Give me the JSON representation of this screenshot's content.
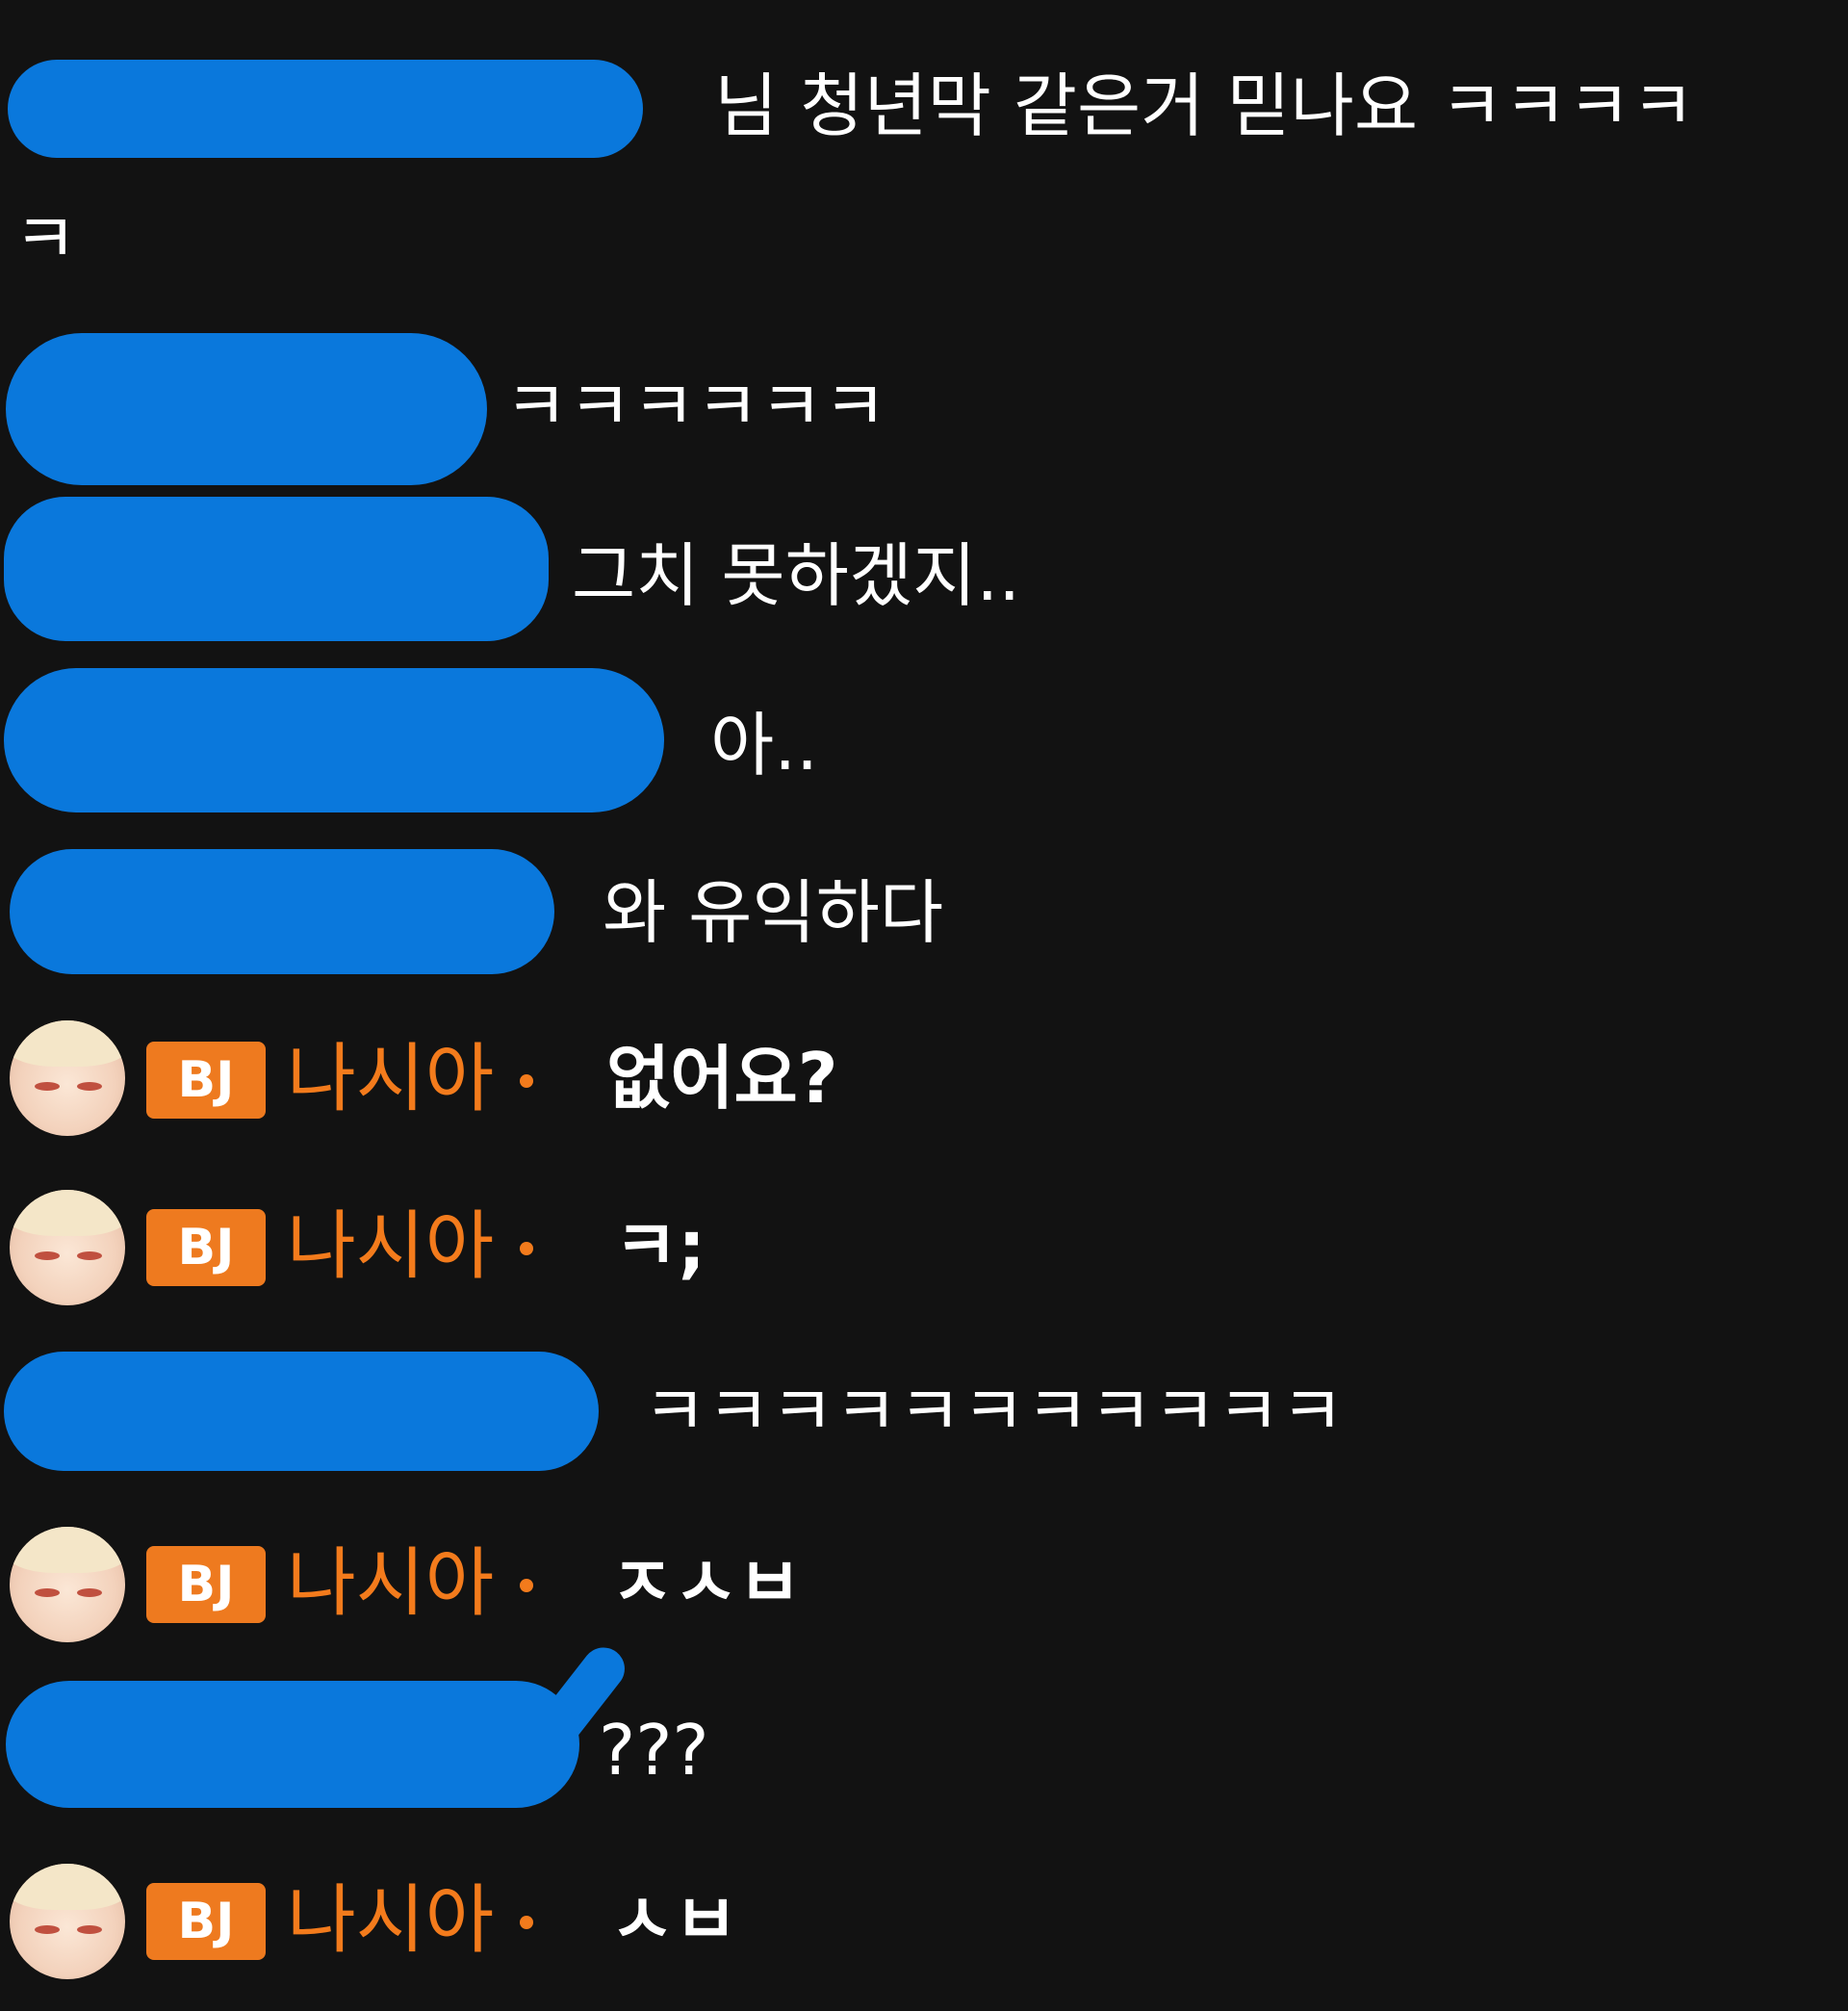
{
  "chat": {
    "messages": [
      {
        "user": "",
        "redacted": true,
        "text": "님 청년막 같은거 믿나요 ㅋㅋㅋㅋ",
        "text_cont": "ㅋ"
      },
      {
        "user": "",
        "redacted": true,
        "text": "ㅋㅋㅋㅋㅋㅋ"
      },
      {
        "user": "",
        "redacted": true,
        "text": "그치 못하겠지.."
      },
      {
        "user": "",
        "redacted": true,
        "text": "아.."
      },
      {
        "user": "",
        "redacted": true,
        "text": "와 유익하다"
      },
      {
        "user": "나시아",
        "badge": "BJ",
        "text": "없어요?"
      },
      {
        "user": "나시아",
        "badge": "BJ",
        "text": "ㅋ;"
      },
      {
        "user": "",
        "redacted": true,
        "text": "ㅋㅋㅋㅋㅋㅋㅋㅋㅋㅋㅋ"
      },
      {
        "user": "나시아",
        "badge": "BJ",
        "text": "ㅈㅅㅂ"
      },
      {
        "user": "",
        "redacted": true,
        "text": "???"
      },
      {
        "user": "나시아",
        "badge": "BJ",
        "text": "ㅅㅂ"
      }
    ]
  },
  "colors": {
    "background": "#121212",
    "bj_badge": "#ee7a1f",
    "bj_nickname": "#f37b1c",
    "message_text": "#ffffff",
    "redaction_marker": "#0a78dc"
  },
  "icons": {
    "avatar": "avatar-icon",
    "badge": "bj-badge"
  }
}
